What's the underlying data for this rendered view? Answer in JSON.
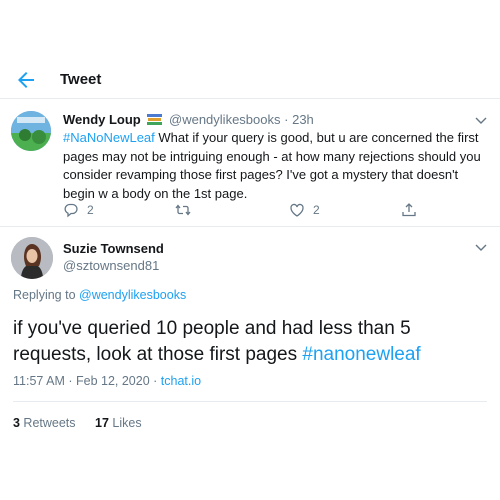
{
  "header": {
    "title": "Tweet"
  },
  "reply_tweet": {
    "author_name": "Wendy Loup",
    "author_handle": "@wendylikesbooks",
    "separator": "·",
    "time": "23h",
    "hashtag": "#NaNoNewLeaf",
    "text": " What if your query is good, but u are concerned the first pages may not be intriguing enough - at how many rejections should you consider revamping those first pages? I've got a mystery that doesn't begin w a body on the 1st page.",
    "replies": "2",
    "retweets": "",
    "likes": "2"
  },
  "main_tweet": {
    "author_name": "Suzie Townsend",
    "author_handle": "@sztownsend81",
    "replying_to_prefix": "Replying to ",
    "replying_to": "@wendylikesbooks",
    "text": "if you've queried 10 people and had less than 5 requests, look at those first pages ",
    "hashtag": "#nanonewleaf",
    "timestamp": "11:57 AM · Feb 12, 2020 · ",
    "source": "tchat.io",
    "retweets_count": "3",
    "retweets_label": " Retweets",
    "likes_count": "17",
    "likes_label": " Likes"
  },
  "colors": {
    "accent": "#1da1f2",
    "muted": "#657786",
    "text": "#14171a",
    "divider": "#e6ecf0"
  },
  "icons": [
    "back-arrow-icon",
    "chevron-down-icon",
    "books-icon",
    "reply-icon",
    "retweet-icon",
    "like-icon",
    "share-icon"
  ]
}
